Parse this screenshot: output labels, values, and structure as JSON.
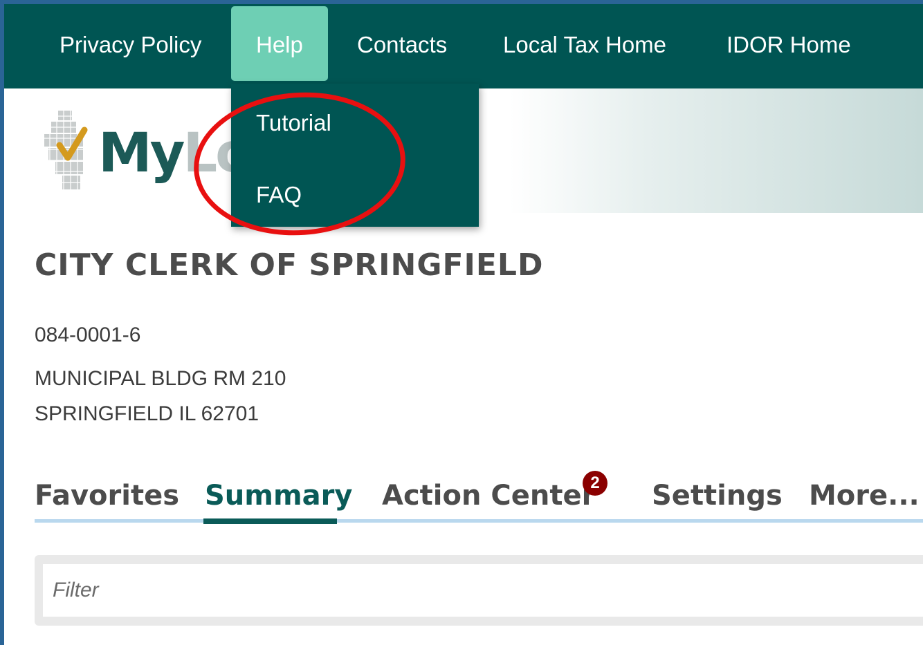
{
  "nav": {
    "items": [
      {
        "label": "Privacy Policy"
      },
      {
        "label": "Help"
      },
      {
        "label": "Contacts"
      },
      {
        "label": "Local Tax Home"
      },
      {
        "label": "IDOR Home"
      }
    ],
    "active": "Help"
  },
  "help_menu": {
    "items": [
      {
        "label": "Tutorial"
      },
      {
        "label": "FAQ"
      }
    ]
  },
  "logo": {
    "text_visible": "My",
    "text_faded": "Lo",
    "check_color": "#d49a1e"
  },
  "org": {
    "name": "CITY CLERK OF SPRINGFIELD",
    "id": "084-0001-6",
    "address_line1": "MUNICIPAL BLDG RM 210",
    "address_line2": "SPRINGFIELD IL 62701"
  },
  "tabs": {
    "items": [
      {
        "label": "Favorites"
      },
      {
        "label": "Summary"
      },
      {
        "label": "Action Center"
      },
      {
        "label": "Settings"
      },
      {
        "label": "More..."
      }
    ],
    "active": "Summary",
    "action_center_badge": "2"
  },
  "filter": {
    "placeholder": "Filter",
    "value": ""
  },
  "colors": {
    "nav_bg": "#005553",
    "nav_active_bg": "#6ecfb4",
    "accent": "#0a5b58",
    "badge": "#8b0000",
    "annotation": "#e81010"
  }
}
